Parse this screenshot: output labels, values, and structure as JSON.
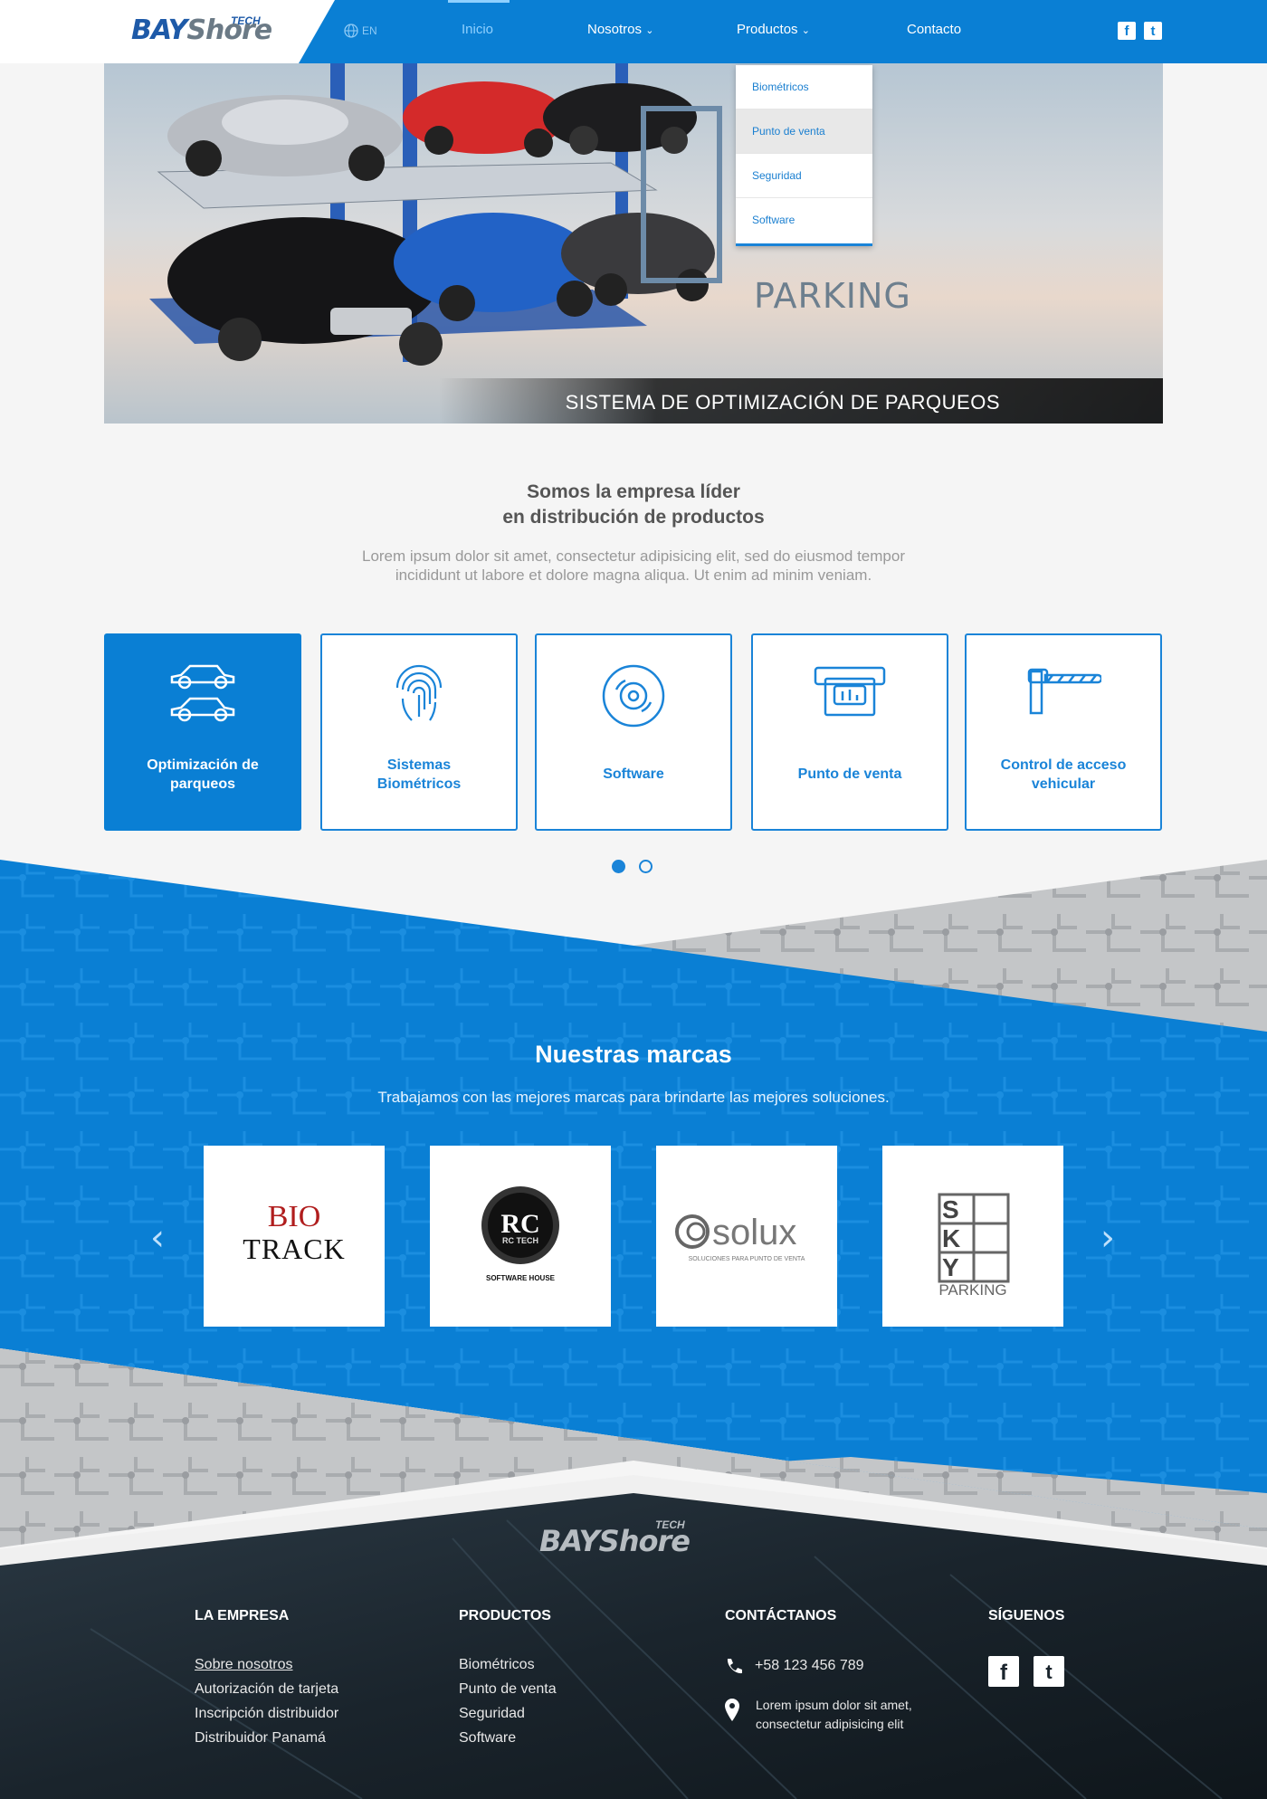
{
  "header": {
    "logo_main": "BAYShore",
    "logo_tech": "TECH",
    "lang": "EN",
    "nav": {
      "inicio": "Inicio",
      "nosotros": "Nosotros",
      "productos": "Productos",
      "contacto": "Contacto"
    },
    "social": {
      "facebook": "f",
      "twitter": "t"
    }
  },
  "dropdown": {
    "items": [
      "Biométricos",
      "Punto de venta",
      "Seguridad",
      "Software"
    ],
    "active_index": 1
  },
  "hero": {
    "caption": "SISTEMA DE OPTIMIZACIÓN DE PARQUEOS",
    "brand_badge": "PARKING"
  },
  "intro": {
    "title_line1": "Somos la empresa líder",
    "title_line2": "en distribución de productos",
    "text_line1": "Lorem ipsum dolor sit amet, consectetur adipisicing elit, sed do eiusmod tempor",
    "text_line2": "incididunt ut labore et dolore magna aliqua. Ut enim ad minim veniam."
  },
  "cards": [
    {
      "label_line1": "Optimización de",
      "label_line2": "parqueos",
      "icon": "cars-icon",
      "active": true
    },
    {
      "label_line1": "Sistemas",
      "label_line2": "Biométricos",
      "icon": "fingerprint-icon",
      "active": false
    },
    {
      "label_line1": "Software",
      "label_line2": "",
      "icon": "disc-icon",
      "active": false
    },
    {
      "label_line1": "Punto de venta",
      "label_line2": "",
      "icon": "pos-terminal-icon",
      "active": false
    },
    {
      "label_line1": "Control de acceso",
      "label_line2": "vehicular",
      "icon": "barrier-gate-icon",
      "active": false
    }
  ],
  "carousel": {
    "dots": 2,
    "active_dot": 0
  },
  "brands": {
    "title": "Nuestras marcas",
    "subtitle": "Trabajamos con las mejores marcas para brindarte las mejores soluciones.",
    "items": [
      {
        "name_line1": "BIO",
        "name_line2": "TRACK"
      },
      {
        "name_line1": "RC TECH",
        "name_line2": "SOFTWARE HOUSE"
      },
      {
        "name_line1": "solux",
        "name_line2": "SOLUCIONES PARA PUNTO DE VENTA"
      },
      {
        "name_line1": "SKY",
        "name_line2": "PARKING"
      }
    ],
    "prev": "‹",
    "next": "›"
  },
  "footer": {
    "logo_main": "BAYShore",
    "logo_tech": "TECH",
    "empresa": {
      "heading": "LA EMPRESA",
      "links": [
        "Sobre nosotros",
        "Autorización de tarjeta",
        "Inscripción distribuidor",
        "Distribuidor Panamá"
      ]
    },
    "productos": {
      "heading": "PRODUCTOS",
      "links": [
        "Biométricos",
        "Punto de venta",
        "Seguridad",
        "Software"
      ]
    },
    "contacto": {
      "heading": "CONTÁCTANOS",
      "phone": "+58 123 456 789",
      "address_line1": "Lorem ipsum dolor sit amet,",
      "address_line2": "consectetur adipisicing elit"
    },
    "siguenos": {
      "heading": "SÍGUENOS",
      "facebook": "f",
      "twitter": "t"
    }
  },
  "colors": {
    "primary": "#0a7fd4",
    "accent": "#1a84d8",
    "footer_bg": "#1f2a33"
  }
}
